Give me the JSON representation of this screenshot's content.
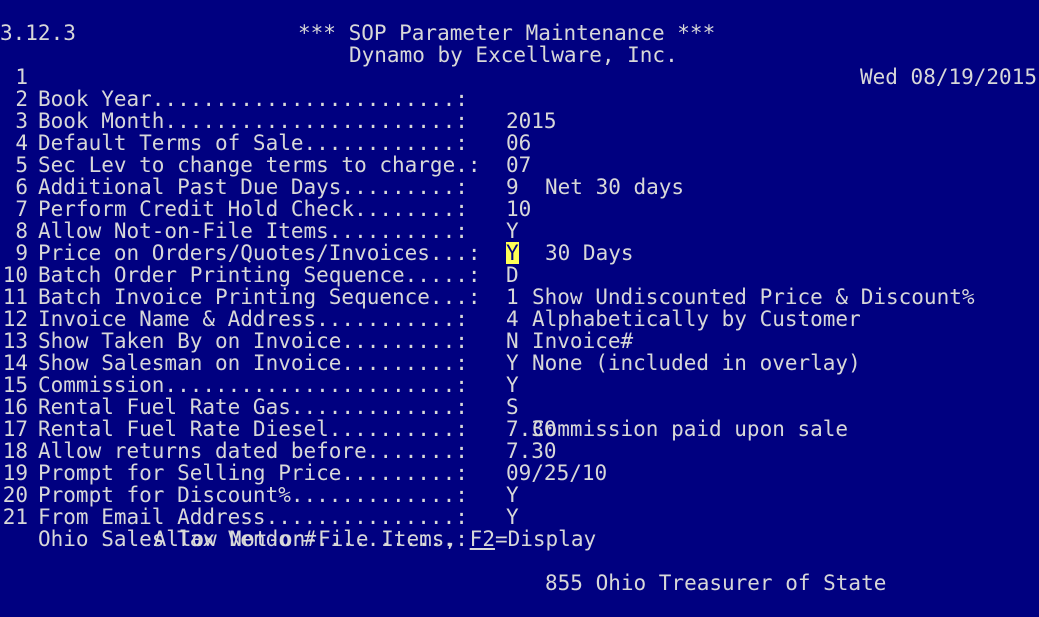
{
  "header": {
    "version": "3.12.3",
    "company": "Dynamo by Excellware, Inc.",
    "date": "Wed 08/19/2015",
    "title": "*** SOP Parameter Maintenance ***"
  },
  "fields": [
    {
      "num": "1",
      "label": "Book Year........................:",
      "value": "2015",
      "desc": ""
    },
    {
      "num": "2",
      "label": "Book Month.......................:",
      "value": "06",
      "desc": ""
    },
    {
      "num": "3",
      "label": "Default Terms of Sale............:",
      "value": "07",
      "desc": "Net 30 days"
    },
    {
      "num": "4",
      "label": "Sec Lev to change terms to charge.:",
      "value": "9",
      "desc": ""
    },
    {
      "num": "5",
      "label": "Additional Past Due Days.........:",
      "value": "10",
      "desc": ""
    },
    {
      "num": "6",
      "label": "Perform Credit Hold Check........:",
      "value": "Y",
      "desc": "30 Days"
    },
    {
      "num": "7",
      "label": "Allow Not-on-File Items..........:",
      "value": "Y",
      "desc": ""
    },
    {
      "num": "8",
      "label": "Price on Orders/Quotes/Invoices...:",
      "value": "D",
      "desc": "Show Undiscounted Price & Discount%"
    },
    {
      "num": "9",
      "label": "Batch Order Printing Sequence.....:",
      "value": "1",
      "desc": "Alphabetically by Customer"
    },
    {
      "num": "10",
      "label": "Batch Invoice Printing Sequence...:",
      "value": "4",
      "desc": "Invoice#"
    },
    {
      "num": "11",
      "label": "Invoice Name & Address...........:",
      "value": "N",
      "desc": "None (included in overlay)"
    },
    {
      "num": "12",
      "label": "Show Taken By on Invoice.........:",
      "value": "Y",
      "desc": ""
    },
    {
      "num": "13",
      "label": "Show Salesman on Invoice.........:",
      "value": "Y",
      "desc": ""
    },
    {
      "num": "14",
      "label": "Commission.......................:",
      "value": "S",
      "desc": "Commission paid upon sale"
    },
    {
      "num": "15",
      "label": "Rental Fuel Rate Gas.............:",
      "value": "7.30",
      "desc": ""
    },
    {
      "num": "16",
      "label": "Rental Fuel Rate Diesel..........:",
      "value": "7.30",
      "desc": ""
    },
    {
      "num": "17",
      "label": "Allow returns dated before.......:",
      "value": "09/25/10",
      "desc": ""
    },
    {
      "num": "18",
      "label": "Prompt for Selling Price.........:",
      "value": "Y",
      "desc": ""
    },
    {
      "num": "19",
      "label": "Prompt for Discount%.............:",
      "value": "Y",
      "desc": ""
    },
    {
      "num": "20",
      "label": "From Email Address...............:",
      "value": "",
      "desc": ""
    },
    {
      "num": "21",
      "label": "Ohio Sales Tax Vendor#...........:",
      "value": "",
      "desc": "855 Ohio Treasurer of State"
    }
  ],
  "status": {
    "prompt": "Allow Not-on-File Items,",
    "key": "F2",
    "key_action": "=Display"
  },
  "colors": {
    "background": "#000080",
    "text": "#d8d8d8",
    "cursor_bg": "#ffff55"
  }
}
